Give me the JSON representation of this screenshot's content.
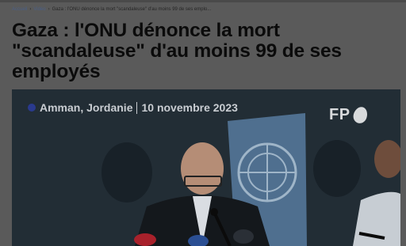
{
  "breadcrumb": {
    "items": [
      {
        "label": "Accueil"
      },
      {
        "label": "Vidéo"
      },
      {
        "label": "Gaza : l'ONU dénonce la mort \"scandaleuse\" d'au moins 99 de ses emplo..."
      }
    ],
    "separator": "›"
  },
  "article": {
    "title": "Gaza : l'ONU dénonce la mort \"scandaleuse\" d'au moins 99 de ses employés"
  },
  "video": {
    "location": "Amman, Jordanie",
    "date": "10 novembre 2023",
    "logo_text": "FP",
    "location_dot_color": "#2a3a8e"
  },
  "colors": {
    "page_overlay": "#5a5a5a",
    "breadcrumb_link": "#4a5f86",
    "headline": "#0b0b0b"
  }
}
